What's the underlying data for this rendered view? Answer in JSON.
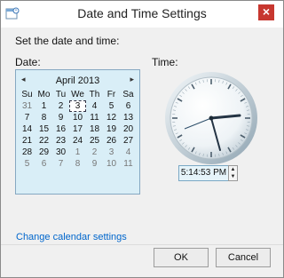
{
  "window": {
    "title": "Date and Time Settings",
    "close_glyph": "×"
  },
  "main": {
    "intro": "Set the date and time:",
    "date_label": "Date:",
    "time_label": "Time:"
  },
  "calendar": {
    "month_year": "April 2013",
    "prev_glyph": "◂",
    "next_glyph": "▸",
    "weekdays": [
      "Su",
      "Mo",
      "Tu",
      "We",
      "Th",
      "Fr",
      "Sa"
    ],
    "weeks": [
      [
        "31",
        "1",
        "2",
        "3",
        "4",
        "5",
        "6"
      ],
      [
        "7",
        "8",
        "9",
        "10",
        "11",
        "12",
        "13"
      ],
      [
        "14",
        "15",
        "16",
        "17",
        "18",
        "19",
        "20"
      ],
      [
        "21",
        "22",
        "23",
        "24",
        "25",
        "26",
        "27"
      ],
      [
        "28",
        "29",
        "30",
        "1",
        "2",
        "3",
        "4"
      ],
      [
        "5",
        "6",
        "7",
        "8",
        "9",
        "10",
        "11"
      ]
    ],
    "selected_day": "3"
  },
  "time": {
    "value": "5:14:53 PM",
    "up_glyph": "▲",
    "down_glyph": "▼"
  },
  "footer": {
    "change_calendar_link": "Change calendar settings",
    "ok": "OK",
    "cancel": "Cancel"
  }
}
